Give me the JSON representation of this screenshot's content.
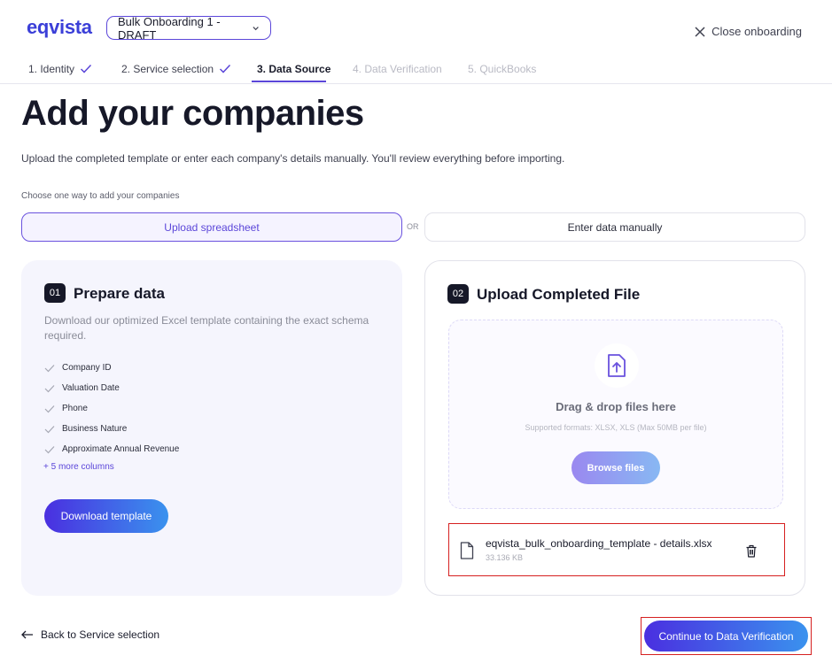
{
  "header": {
    "logo": "eqvista",
    "draft_select": "Bulk Onboarding 1 - DRAFT",
    "close_label": "Close onboarding"
  },
  "steps": [
    {
      "label": "1. Identity",
      "state": "done"
    },
    {
      "label": "2. Service selection",
      "state": "done"
    },
    {
      "label": "3. Data Source",
      "state": "active"
    },
    {
      "label": "4. Data Verification",
      "state": "disabled"
    },
    {
      "label": "5. QuickBooks",
      "state": "disabled"
    }
  ],
  "main": {
    "title": "Add your companies",
    "subtitle": "Upload the completed template or enter each company's details manually. You'll review everything before importing.",
    "choose_label": "Choose one way to add your companies",
    "upload_option": "Upload spreadsheet",
    "or_label": "OR",
    "manual_option": "Enter data manually"
  },
  "prepare": {
    "number": "01",
    "title": "Prepare data",
    "description": "Download our optimized Excel template containing the exact schema required.",
    "columns": [
      "Company ID",
      "Valuation Date",
      "Phone",
      "Business Nature",
      "Approximate Annual Revenue"
    ],
    "more_columns": "+ 5 more columns",
    "download_button": "Download template"
  },
  "upload": {
    "number": "02",
    "title": "Upload Completed File",
    "dropzone_title": "Drag & drop files here",
    "formats": "Supported formats: XLSX, XLS (Max 50MB per file)",
    "browse_button": "Browse files",
    "file_name": "eqvista_bulk_onboarding_template - details.xlsx",
    "file_size": "33.136 KB"
  },
  "footer": {
    "back_label": "Back to Service selection",
    "continue_label": "Continue to Data Verification"
  },
  "colors": {
    "accent": "#5b46d9",
    "highlight_border": "#d62020"
  }
}
